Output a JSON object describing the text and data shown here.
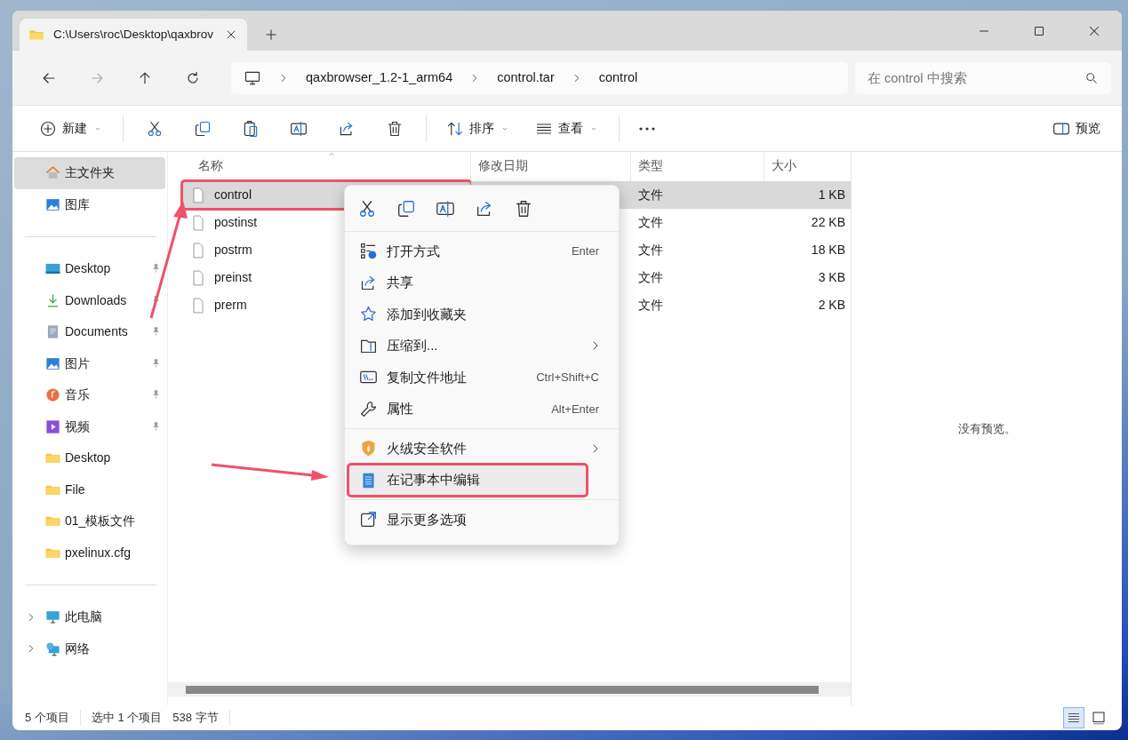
{
  "window": {
    "tab_title": "C:\\Users\\roc\\Desktop\\qaxbrov"
  },
  "address": {
    "breadcrumbs": [
      "qaxbrowser_1.2-1_arm64",
      "control.tar",
      "control"
    ]
  },
  "search": {
    "placeholder": "在 control 中搜索"
  },
  "toolbar": {
    "new_label": "新建",
    "sort_label": "排序",
    "view_label": "查看",
    "preview_label": "预览"
  },
  "sidebar": {
    "sections": [
      [
        {
          "label": "主文件夹",
          "kind": "home",
          "selected": true,
          "pinned": false
        },
        {
          "label": "图库",
          "kind": "gallery",
          "selected": false,
          "pinned": false
        }
      ],
      [
        {
          "label": "Desktop",
          "kind": "desktop",
          "selected": false,
          "pinned": true
        },
        {
          "label": "Downloads",
          "kind": "downloads",
          "selected": false,
          "pinned": true
        },
        {
          "label": "Documents",
          "kind": "documents",
          "selected": false,
          "pinned": true
        },
        {
          "label": "图片",
          "kind": "pictures",
          "selected": false,
          "pinned": true
        },
        {
          "label": "音乐",
          "kind": "music",
          "selected": false,
          "pinned": true
        },
        {
          "label": "视频",
          "kind": "videos",
          "selected": false,
          "pinned": true
        },
        {
          "label": "Desktop",
          "kind": "folder",
          "selected": false,
          "pinned": false
        },
        {
          "label": "File",
          "kind": "folder",
          "selected": false,
          "pinned": false
        },
        {
          "label": "01_模板文件",
          "kind": "folder",
          "selected": false,
          "pinned": false
        },
        {
          "label": "pxelinux.cfg",
          "kind": "folder",
          "selected": false,
          "pinned": false
        }
      ],
      [
        {
          "label": "此电脑",
          "kind": "pc",
          "selected": false,
          "pinned": false,
          "expanded": false
        },
        {
          "label": "网络",
          "kind": "network",
          "selected": false,
          "pinned": false,
          "expanded": false
        }
      ]
    ]
  },
  "table": {
    "columns": [
      "名称",
      "修改日期",
      "类型",
      "大小"
    ],
    "rows": [
      {
        "name": "control",
        "type": "文件",
        "size": "1 KB",
        "selected": true,
        "annotated": true
      },
      {
        "name": "postinst",
        "type": "文件",
        "size": "22 KB",
        "selected": false,
        "annotated": false
      },
      {
        "name": "postrm",
        "type": "文件",
        "size": "18 KB",
        "selected": false,
        "annotated": false
      },
      {
        "name": "preinst",
        "type": "文件",
        "size": "3 KB",
        "selected": false,
        "annotated": false
      },
      {
        "name": "prerm",
        "type": "文件",
        "size": "2 KB",
        "selected": false,
        "annotated": false
      }
    ]
  },
  "preview": {
    "message": "没有预览。"
  },
  "context_menu": {
    "groups": [
      [
        {
          "label": "打开方式",
          "kind": "open-with",
          "shortcut": "Enter",
          "submenu": false,
          "selected": false,
          "annotated": false
        },
        {
          "label": "共享",
          "kind": "share",
          "submenu": false,
          "selected": false,
          "annotated": false
        },
        {
          "label": "添加到收藏夹",
          "kind": "star",
          "submenu": false,
          "selected": false,
          "annotated": false
        },
        {
          "label": "压缩到...",
          "kind": "zip",
          "submenu": true,
          "selected": false,
          "annotated": false
        },
        {
          "label": "复制文件地址",
          "kind": "path",
          "shortcut": "Ctrl+Shift+C",
          "submenu": false,
          "selected": false,
          "annotated": false
        },
        {
          "label": "属性",
          "kind": "wrench",
          "shortcut": "Alt+Enter",
          "submenu": false,
          "selected": false,
          "annotated": false
        }
      ],
      [
        {
          "label": "火绒安全软件",
          "kind": "shield",
          "submenu": true,
          "selected": false,
          "annotated": false
        },
        {
          "label": "在记事本中编辑",
          "kind": "notepad",
          "submenu": false,
          "selected": true,
          "annotated": true
        }
      ],
      [
        {
          "label": "显示更多选项",
          "kind": "more-options",
          "submenu": false,
          "selected": false,
          "annotated": false
        }
      ]
    ]
  },
  "status_bar": {
    "item_count": "5 个项目",
    "selection": "选中 1 个项目",
    "size": "538 字节",
    "views": [
      {
        "kind": "details",
        "selected": true
      },
      {
        "kind": "tiles",
        "selected": false
      }
    ]
  }
}
